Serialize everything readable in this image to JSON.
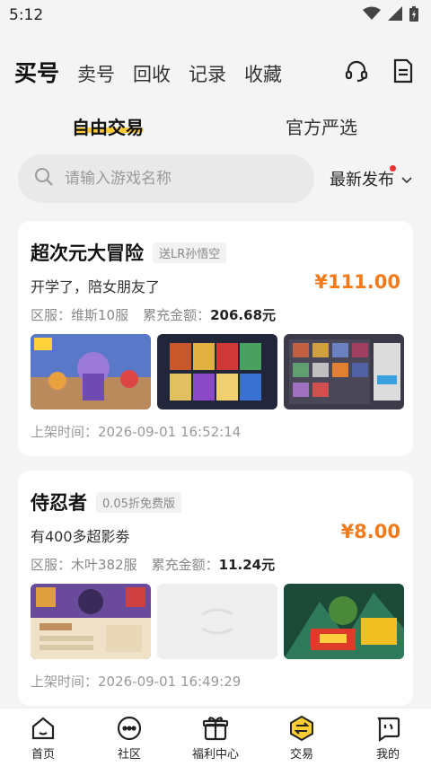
{
  "status": {
    "time": "5:12"
  },
  "header": {
    "tabs": [
      {
        "label": "买号",
        "active": true
      },
      {
        "label": "卖号",
        "active": false
      },
      {
        "label": "回收",
        "active": false
      },
      {
        "label": "记录",
        "active": false
      },
      {
        "label": "收藏",
        "active": false
      }
    ],
    "icons": [
      "headset-icon",
      "document-icon"
    ]
  },
  "sub_tabs": [
    {
      "label": "自由交易",
      "active": true
    },
    {
      "label": "官方严选",
      "active": false
    }
  ],
  "search": {
    "placeholder": "请输入游戏名称",
    "sort_label": "最新发布"
  },
  "listings": [
    {
      "title": "超次元大冒险",
      "tag": "送LR孙悟空",
      "desc": "开学了，陪女朋友了",
      "price": "¥111.00",
      "server_label": "区服：",
      "server": "维斯10服",
      "recharge_label": "累充金额：",
      "recharge": "206.68元",
      "time": "上架时间：2026-09-01 16:52:14"
    },
    {
      "title": "侍忍者",
      "tag": "0.05折免费版",
      "desc": "有400多超影劵",
      "price": "¥8.00",
      "server_label": "区服：",
      "server": "木叶382服",
      "recharge_label": "累充金额：",
      "recharge": "11.24元",
      "time": "上架时间：2026-09-01 16:49:29"
    }
  ],
  "bottom_nav": [
    {
      "label": "首页",
      "icon": "home-icon"
    },
    {
      "label": "社区",
      "icon": "chat-icon"
    },
    {
      "label": "福利中心",
      "icon": "gift-icon"
    },
    {
      "label": "交易",
      "icon": "trade-icon",
      "active": true
    },
    {
      "label": "我的",
      "icon": "profile-icon"
    }
  ],
  "colors": {
    "accent": "#ffcc33",
    "price": "#f27a1a",
    "notify_dot": "#f03030"
  }
}
